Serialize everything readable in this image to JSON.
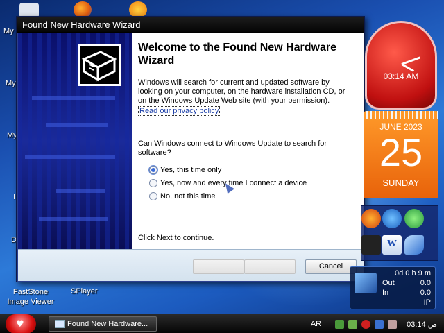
{
  "desktop": {
    "labels": [
      "My",
      "My",
      "My",
      "I",
      "D"
    ],
    "faststone": "FastStone\nImage Viewer",
    "splayer": "SPlayer"
  },
  "wizard": {
    "title": "Found New Hardware Wizard",
    "heading": "Welcome to the Found New Hardware Wizard",
    "intro": "Windows will search for current and updated software by looking on your computer, on the hardware installation CD, or on the Windows Update Web site (with your permission).",
    "privacy_link": "Read our privacy policy",
    "question": "Can Windows connect to Windows Update to search for software?",
    "options": [
      {
        "label": "Yes, this time only",
        "selected": true
      },
      {
        "label": "Yes, now and every time I connect a device",
        "selected": false
      },
      {
        "label": "No, not this time",
        "selected": false
      }
    ],
    "continue_text": "Click Next to continue.",
    "back_label": "",
    "next_label": "",
    "cancel_label": "Cancel"
  },
  "gadgets": {
    "clock_time": "03:14 AM",
    "calendar_month": "JUNE 2023",
    "calendar_day": "25",
    "calendar_weekday": "SUNDAY",
    "net_uptime": "0d 0 h 9 m",
    "net_out_label": "Out",
    "net_out_value": "0.0",
    "net_in_label": "In",
    "net_in_value": "0.0",
    "net_ip_label": "IP"
  },
  "taskbar": {
    "task_label": "Found New Hardware...",
    "language": "AR",
    "time": "03:14 ص"
  },
  "colors": {
    "accent": "#1a3ea8",
    "clock": "#d81010",
    "calendar": "#f07a1a"
  }
}
